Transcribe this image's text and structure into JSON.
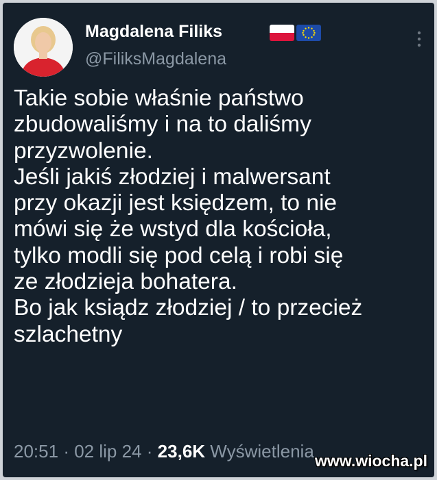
{
  "tweet": {
    "author": {
      "display_name": "Magdalena Filiks",
      "handle": "@FiliksMagdalena",
      "flags": [
        "poland-flag-icon",
        "eu-flag-icon"
      ]
    },
    "text": "Takie sobie właśnie państwo\nzbudowaliśmy i na to daliśmy\nprzyzwolenie.\nJeśli jakiś złodziej i malwersant\nprzy okazji jest księdzem, to nie\nmówi się że wstyd dla kościoła,\ntylko modli się pod celą i robi się\nze złodzieja bohatera.\nBo jak ksiądz złodziej / to przecież\nszlachetny",
    "time": "20:51",
    "separator": "·",
    "date": "02 lip 24",
    "views_count": "23,6K",
    "views_label": "Wyświetlenia"
  },
  "watermark": "www.wiocha.pl",
  "colors": {
    "background": "#15202b",
    "text": "#ffffff",
    "secondary": "#8b98a5"
  }
}
